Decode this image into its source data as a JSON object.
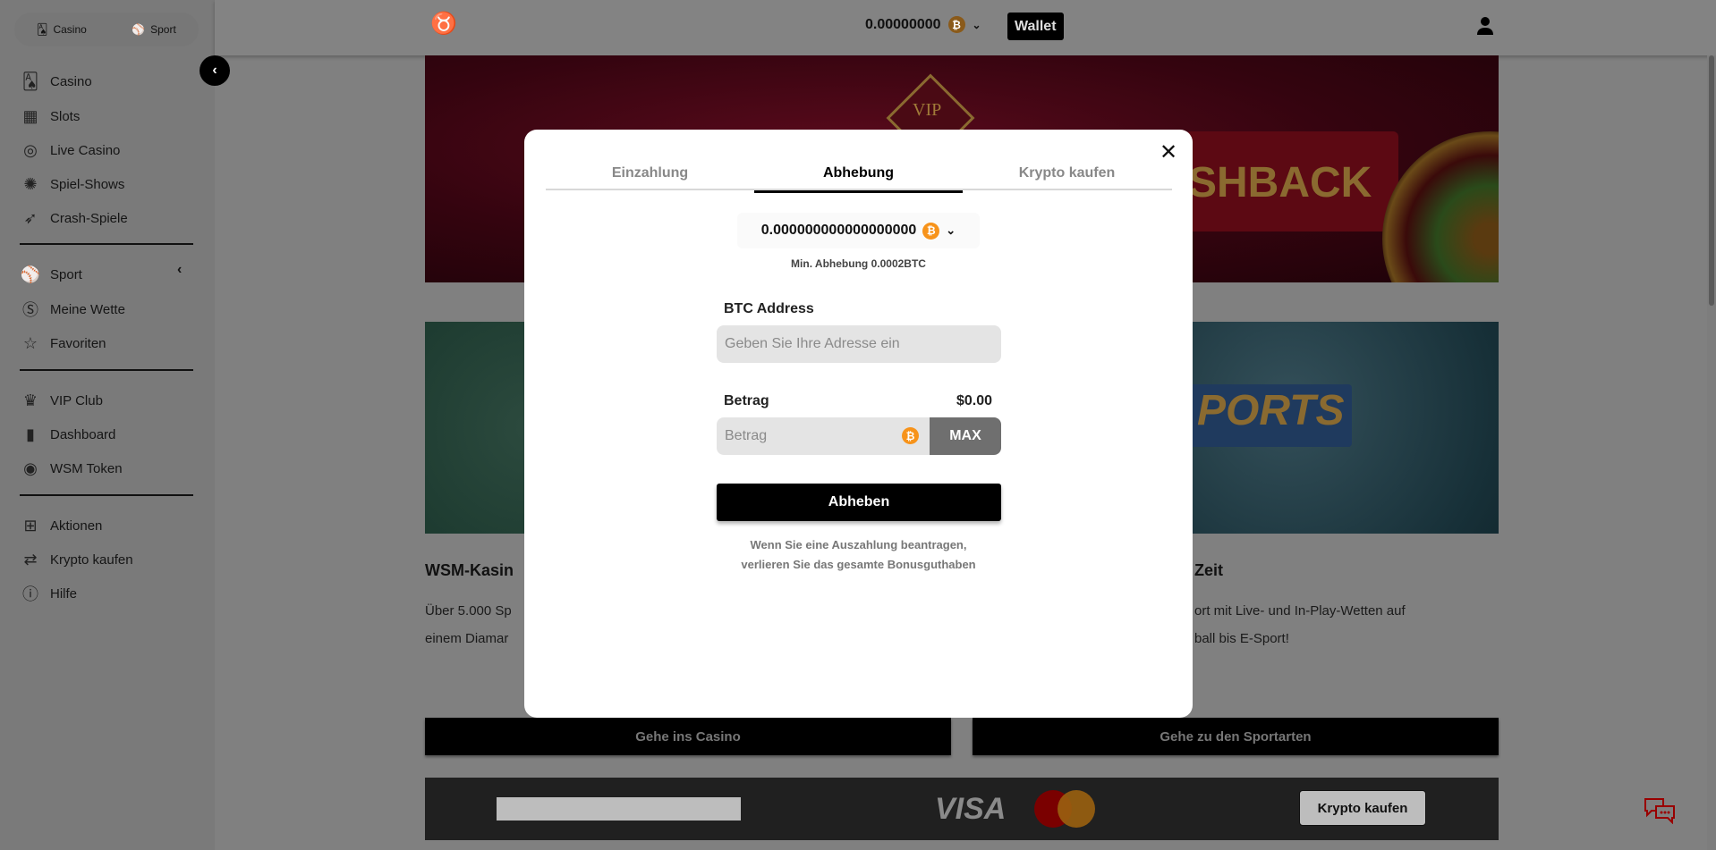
{
  "sidebar": {
    "toggle": [
      {
        "label": "Casino",
        "icon": "cards-icon"
      },
      {
        "label": "Sport",
        "icon": "sports-balls-icon"
      }
    ],
    "items": [
      {
        "label": "Casino",
        "icon": "cards-icon"
      },
      {
        "label": "Slots",
        "icon": "slot-machine-icon"
      },
      {
        "label": "Live Casino",
        "icon": "roulette-icon"
      },
      {
        "label": "Spiel-Shows",
        "icon": "wheel-icon"
      },
      {
        "label": "Crash-Spiele",
        "icon": "rocket-icon"
      },
      {
        "label": "Sport",
        "icon": "sports-balls-icon"
      },
      {
        "label": "Meine Wette",
        "icon": "coin-icon"
      },
      {
        "label": "Favoriten",
        "icon": "star-icon"
      },
      {
        "label": "VIP Club",
        "icon": "crown-icon"
      },
      {
        "label": "Dashboard",
        "icon": "bar-chart-icon"
      },
      {
        "label": "WSM Token",
        "icon": "token-icon"
      },
      {
        "label": "Aktionen",
        "icon": "gift-icon"
      },
      {
        "label": "Krypto kaufen",
        "icon": "crypto-exchange-icon"
      },
      {
        "label": "Hilfe",
        "icon": "help-icon"
      }
    ]
  },
  "header": {
    "balance": "0.00000000",
    "currency_icon": "bitcoin-icon",
    "wallet_label": "Wallet"
  },
  "banner": {
    "text_vip": "VIP",
    "text_cashback": "SHBACK"
  },
  "cards": {
    "left": {
      "title": "WSM-Kasin",
      "line1": "Über 5.000 Sp",
      "line2": "einem Diamar"
    },
    "right": {
      "image_text": "PORTS",
      "title": "Zeit",
      "line1": "ort mit Live- und In-Play-Wetten auf",
      "line2": "ball bis E-Sport!"
    }
  },
  "buttons": {
    "casino": "Gehe ins Casino",
    "sports": "Gehe zu den Sportarten"
  },
  "footer": {
    "visa": "VISA",
    "krypto": "Krypto kaufen"
  },
  "modal": {
    "tabs": [
      "Einzahlung",
      "Abhebung",
      "Krypto kaufen"
    ],
    "active_tab": "Abhebung",
    "balance": "0.000000000000000000",
    "min_withdraw": "Min. Abhebung 0.0002BTC",
    "address_label": "BTC Address",
    "address_placeholder": "Geben Sie Ihre Adresse ein",
    "amount_label": "Betrag",
    "amount_usd": "$0.00",
    "amount_placeholder": "Betrag",
    "max_label": "MAX",
    "submit_label": "Abheben",
    "warning_line1": "Wenn Sie eine Auszahlung beantragen,",
    "warning_line2": "verlieren Sie das gesamte Bonusguthaben"
  },
  "colors": {
    "accent": "#000000",
    "bitcoin": "#f7931a",
    "overlay": "#808080"
  }
}
